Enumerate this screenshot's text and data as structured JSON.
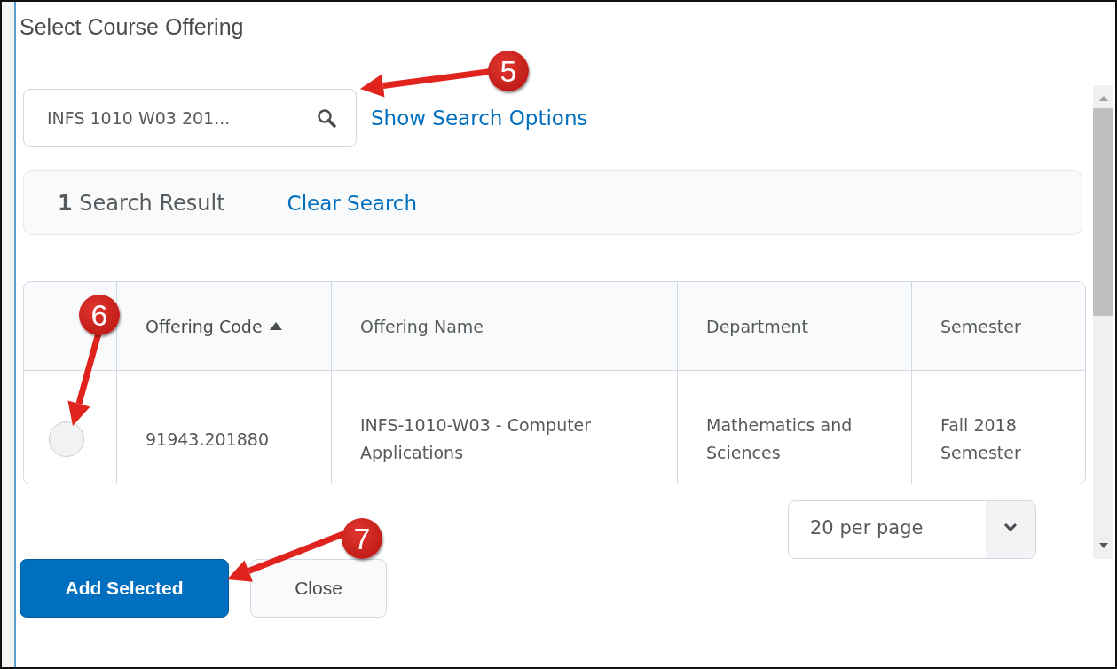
{
  "dialog": {
    "title": "Select Course Offering"
  },
  "search": {
    "value": "INFS 1010 W03 201..."
  },
  "search_options_link": "Show Search Options",
  "results": {
    "summary": "**1** Search Result",
    "clear_link": "Clear Search"
  },
  "table": {
    "columns": [
      {
        "label": "Offering Code",
        "sorted": true
      },
      {
        "label": "Offering Name",
        "sorted": false
      },
      {
        "label": "Department",
        "sorted": false
      },
      {
        "label": "Semester",
        "sorted": false
      }
    ],
    "rows": [
      {
        "selected": false,
        "cells": [
          "91943.201880",
          "INFS-1010-W03 - Computer Applications",
          "Mathematics and Sciences",
          "Fall 2018 Semester"
        ]
      }
    ]
  },
  "per_page": {
    "value": "20 per page"
  },
  "buttons": [
    {
      "label": "Add Selected",
      "kind": "primary"
    },
    {
      "label": "Close",
      "kind": "secondary"
    }
  ],
  "callouts": [
    "5",
    "6",
    "7"
  ]
}
